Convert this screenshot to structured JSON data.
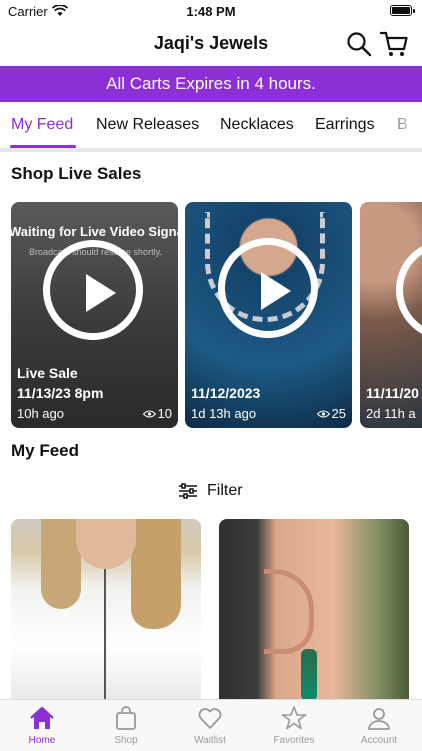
{
  "status_bar": {
    "carrier": "Carrier",
    "time": "1:48 PM"
  },
  "nav": {
    "title": "Jaqi's Jewels",
    "search_icon": "search-icon",
    "cart_icon": "cart-icon"
  },
  "banner": {
    "text": "All Carts Expires in 4 hours.",
    "color": "#8b2fd6"
  },
  "tabs": [
    {
      "label": "My Feed",
      "active": true
    },
    {
      "label": "New Releases"
    },
    {
      "label": "Necklaces"
    },
    {
      "label": "Earrings"
    },
    {
      "label": "B"
    }
  ],
  "live_sales": {
    "title": "Shop Live Sales",
    "cards": [
      {
        "overlay": "Waiting for Live Video Signa",
        "overlay_sub": "Broadcast should resume shortly.",
        "line1": "Live Sale",
        "line2": "11/13/23 8pm",
        "ago": "10h ago",
        "views": "10"
      },
      {
        "line2": "11/12/2023",
        "ago": "1d 13h ago",
        "views": "25"
      },
      {
        "line2": "11/11/20",
        "ago": "2d 11h a"
      }
    ]
  },
  "feed": {
    "title": "My Feed",
    "filter_label": "Filter"
  },
  "tabbar": [
    {
      "label": "Home",
      "icon": "home-icon",
      "active": true
    },
    {
      "label": "Shop",
      "icon": "shopping-bag-icon"
    },
    {
      "label": "Waitlist",
      "icon": "heart-icon"
    },
    {
      "label": "Favorites",
      "icon": "star-icon"
    },
    {
      "label": "Account",
      "icon": "person-icon"
    }
  ],
  "accent_color": "#8b2fd6"
}
